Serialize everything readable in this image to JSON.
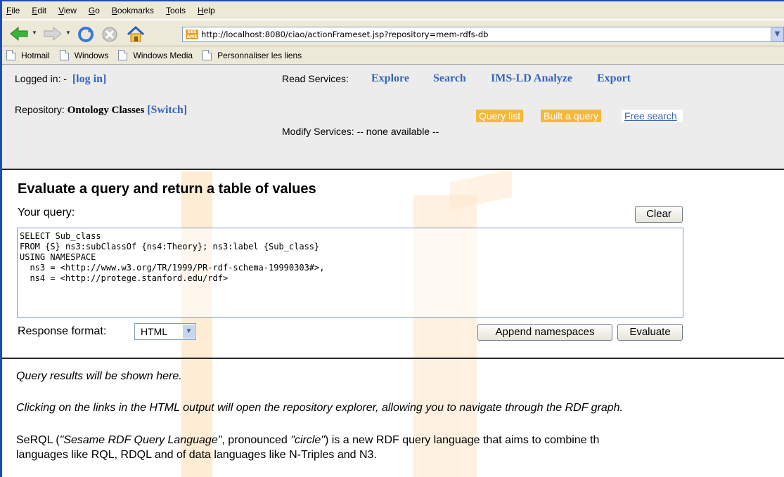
{
  "menubar": {
    "items": [
      "File",
      "Edit",
      "View",
      "Go",
      "Bookmarks",
      "Tools",
      "Help"
    ]
  },
  "toolbar": {
    "url": "http://localhost:8080/ciao/actionFrameset.jsp?repository=mem-rdfs-db",
    "favicon_text": "SES AME",
    "icons": [
      "back-arrow-icon",
      "forward-arrow-icon",
      "reload-icon",
      "stop-icon",
      "home-icon"
    ]
  },
  "links": [
    "Hotmail",
    "Windows",
    "Windows Media",
    "Personnaliser les liens"
  ],
  "top": {
    "logged_label": "Logged in: -",
    "login_link": "[log in]",
    "repository_label": "Repository:",
    "repository_name": "Ontology Classes",
    "switch_link": "[Switch]",
    "read_label": "Read Services:",
    "read_links": [
      "Explore",
      "Search",
      "IMS-LD Analyze",
      "Export"
    ],
    "subtabs": [
      "Query list",
      "Built a query",
      "Free search"
    ],
    "modify_label": "Modify Services: -- none available --"
  },
  "main": {
    "title": "Evaluate a query and return a table of values",
    "query_label": "Your query:",
    "clear": "Clear",
    "query_text": "SELECT Sub_class\nFROM {S} ns3:subClassOf {ns4:Theory}; ns3:label {Sub_class}\nUSING NAMESPACE\n  ns3 = <http://www.w3.org/TR/1999/PR-rdf-schema-19990303#>,\n  ns4 = <http://protege.stanford.edu/rdf>",
    "format_label": "Response format:",
    "format_value": "HTML",
    "append": "Append namespaces",
    "evaluate": "Evaluate"
  },
  "bottom": {
    "line1": "Query results will be shown here.",
    "line2": "Clicking on the links in the HTML output will open the repository explorer, allowing you to navigate through the RDF graph.",
    "p3_a": "SeRQL (",
    "p3_b": "\"Sesame RDF Query Language\"",
    "p3_c": ", pronounced ",
    "p3_d": "\"circle\"",
    "p3_e": ") is a new RDF query language that aims to combine th",
    "p3_line2": "languages like RQL, RDQL and of data languages like N-Triples and N3."
  }
}
